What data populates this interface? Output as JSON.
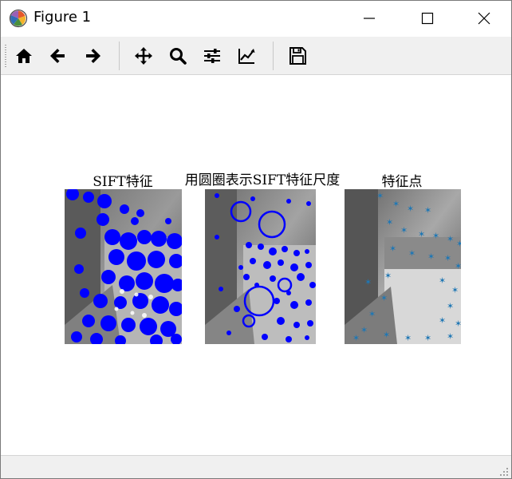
{
  "window": {
    "title": "Figure 1",
    "controls": [
      "minimize",
      "maximize",
      "close"
    ]
  },
  "toolbar": {
    "items": [
      {
        "name": "home",
        "icon": "home-icon"
      },
      {
        "name": "back",
        "icon": "arrow-left-icon"
      },
      {
        "name": "forward",
        "icon": "arrow-right-icon"
      },
      {
        "name": "pan",
        "icon": "move-icon"
      },
      {
        "name": "zoom",
        "icon": "magnifier-icon"
      },
      {
        "name": "configure-subplots",
        "icon": "sliders-icon"
      },
      {
        "name": "edit-axes",
        "icon": "line-chart-icon"
      },
      {
        "name": "save",
        "icon": "floppy-disk-icon"
      }
    ]
  },
  "figure": {
    "subplots": [
      {
        "title": "SIFT特征",
        "marker": "filled-circle",
        "color": "#0000ff"
      },
      {
        "title": "用圆圈表示SIFT特征尺度",
        "marker": "open-circle",
        "color": "#0000ff"
      },
      {
        "title": "特征点",
        "marker": "star",
        "color": "#1f77b4"
      }
    ]
  },
  "colors": {
    "keypoint_blue": "#0000ff",
    "feature_point_blue": "#1f77b4",
    "toolbar_bg": "#f0f0f0"
  }
}
